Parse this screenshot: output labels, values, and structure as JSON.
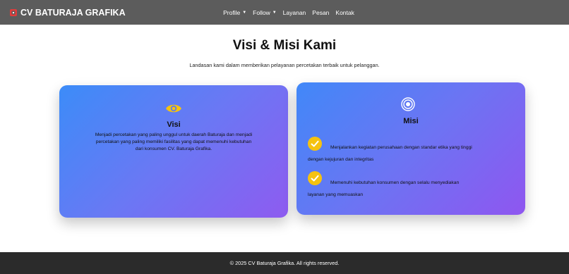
{
  "navbar": {
    "brand": "CV BATURAJA GRAFIKA",
    "links": [
      {
        "label": "Profile",
        "dropdown": true
      },
      {
        "label": "Follow",
        "dropdown": true
      },
      {
        "label": "Layanan",
        "dropdown": false
      },
      {
        "label": "Pesan",
        "dropdown": false
      },
      {
        "label": "Kontak",
        "dropdown": false
      }
    ],
    "caret": "▼"
  },
  "header": {
    "title": "Visi & Misi Kami",
    "subtitle": "Landasan kami dalam memberikan pelayanan percetakan terbaik untuk pelanggan."
  },
  "visi": {
    "icon": "eye-icon",
    "title": "Visi",
    "text_lines": [
      "Menjadi percetakan yang paling unggul untuk daerah Baturaja dan menjadi",
      "percetakan yang paling memiliki fasilitas yang dapat memenuhi kebutuhan",
      "dari konsumen CV. Baturaja Grafika."
    ]
  },
  "misi": {
    "icon": "target-icon",
    "title": "Misi",
    "items": [
      {
        "line1": "Menjalankan kegiatan perusahaan dengan standar etika yang tinggi",
        "line2": "dengan kejujuran dan integritas"
      },
      {
        "line1": "Memenuhi kebutuhan konsumen dengan selalu menyediakan",
        "line2": "layanan yang memuaskan"
      }
    ]
  },
  "footer": {
    "text": "© 2025 CV Baturaja Grafika. All rights reserved."
  },
  "colors": {
    "navbar": "#5c5c5c",
    "footer": "#2b2b2b",
    "accent_yellow": "#f5c211",
    "brand_logo_red": "#e03c3c"
  }
}
